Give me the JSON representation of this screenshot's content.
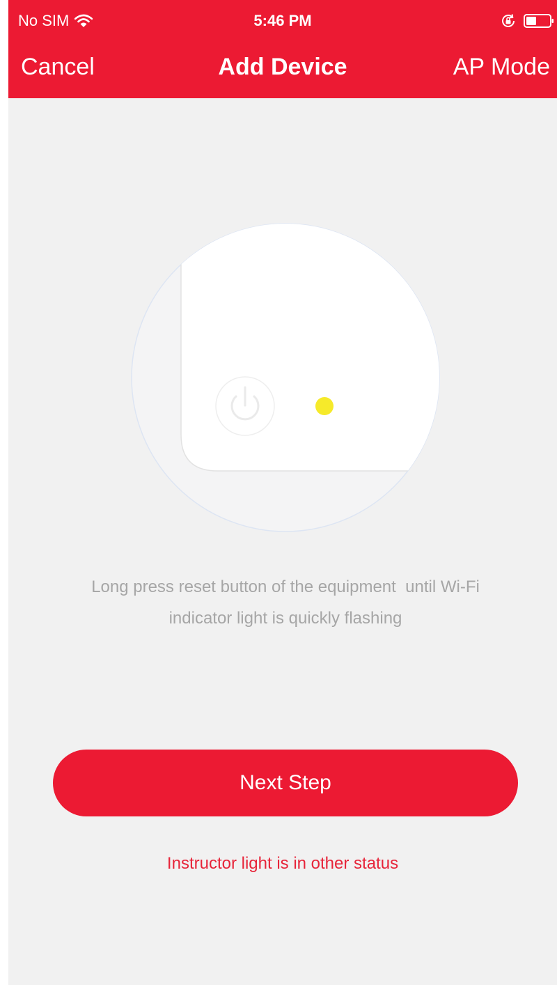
{
  "status_bar": {
    "carrier": "No SIM",
    "time": "5:46 PM",
    "icons": [
      "wifi-icon",
      "rotation-lock-icon",
      "battery-icon"
    ]
  },
  "nav": {
    "cancel_label": "Cancel",
    "title": "Add Device",
    "ap_mode_label": "AP Mode"
  },
  "illustration": {
    "icons": [
      "power-button-icon",
      "indicator-light-icon"
    ],
    "indicator_color": "#f6ea2a"
  },
  "instruction": {
    "line1": "Long press reset button of the equipment  until Wi-Fi",
    "line2": "indicator light is quickly flashing"
  },
  "actions": {
    "next_step_label": "Next Step",
    "other_status_label": "Instructor light is in other status"
  },
  "colors": {
    "accent": "#ec1a33",
    "background": "#f1f1f1",
    "instruction_text": "#a6a6a6"
  }
}
